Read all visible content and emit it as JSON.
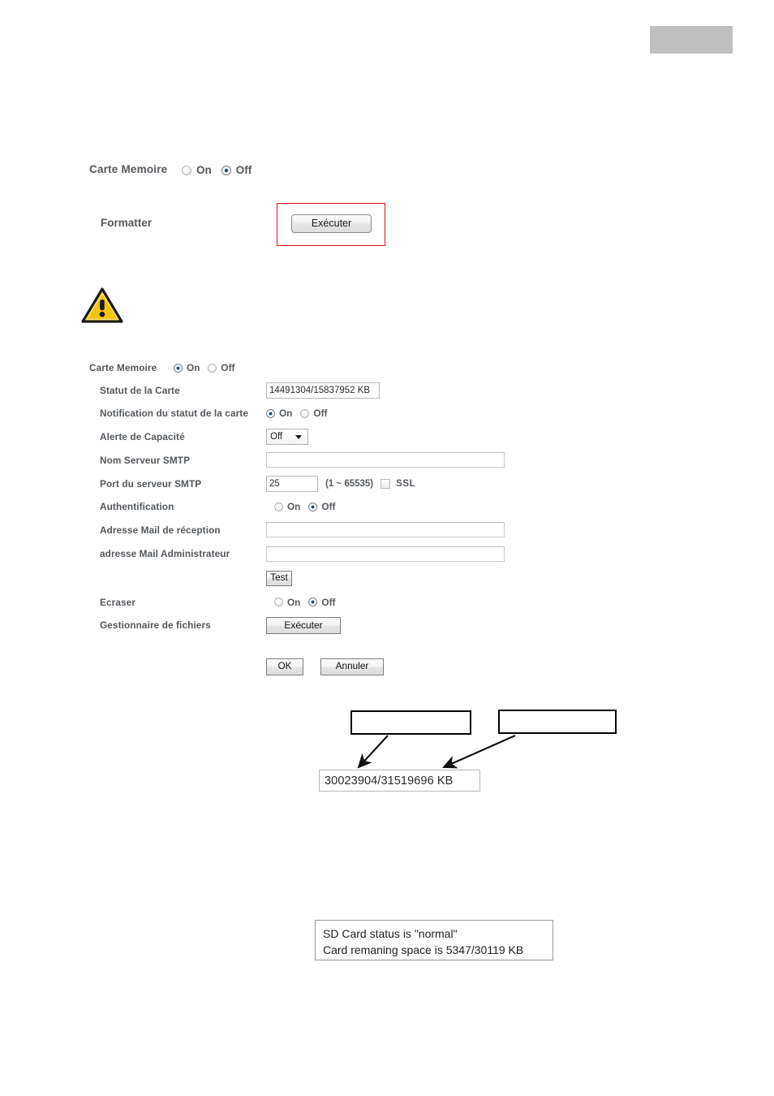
{
  "page": {
    "gray_block_color": "#bfbfbf",
    "highlight_color": "#e10e0e"
  },
  "section1": {
    "label": "Carte Memoire",
    "radio_on_label": "On",
    "radio_off_label": "Off",
    "selected": "Off",
    "formatter_label": "Formatter",
    "formatter_button": "Exécuter"
  },
  "warning": {
    "icon": "warning-triangle-icon",
    "fill": "#f2c300"
  },
  "section2": {
    "title_label": "Carte Memoire",
    "title_on": "On",
    "title_off": "Off",
    "title_selected": "On",
    "rows": {
      "card_status": {
        "label": "Statut de la Carte",
        "value": "14491304/15837952 KB"
      },
      "status_notification": {
        "label": "Notification du statut de la carte",
        "on": "On",
        "off": "Off",
        "selected": "On"
      },
      "capacity_alert": {
        "label": "Alerte de Capacité",
        "value": "Off"
      },
      "smtp_server_name": {
        "label": "Nom Serveur SMTP",
        "value": "",
        "placeholder": ""
      },
      "smtp_port": {
        "label": "Port du serveur SMTP",
        "value": "25",
        "range_note": "(1 ~ 65535)",
        "ssl_label": "SSL",
        "ssl_checked": false
      },
      "authentication": {
        "label": "Authentification",
        "on": "On",
        "off": "Off",
        "selected": "Off"
      },
      "receive_mail": {
        "label": "Adresse Mail de réception",
        "value": "",
        "placeholder": ""
      },
      "admin_mail": {
        "label": "adresse Mail Administrateur",
        "value": "",
        "placeholder": ""
      },
      "test": {
        "button": "Test"
      },
      "overwrite": {
        "label": "Ecraser",
        "on": "On",
        "off": "Off",
        "selected": "Off"
      },
      "file_manager": {
        "label": "Gestionnaire de fichiers",
        "button": "Exécuter"
      }
    },
    "actions": {
      "ok": "OK",
      "cancel": "Annuler"
    }
  },
  "callouts": {
    "box_a_text": "",
    "box_b_text": "",
    "status_value": "30023904/31519696 KB"
  },
  "message_box": {
    "line1": "SD Card status is \"normal\"",
    "line2": "Card remaning space is 5347/30119 KB"
  }
}
